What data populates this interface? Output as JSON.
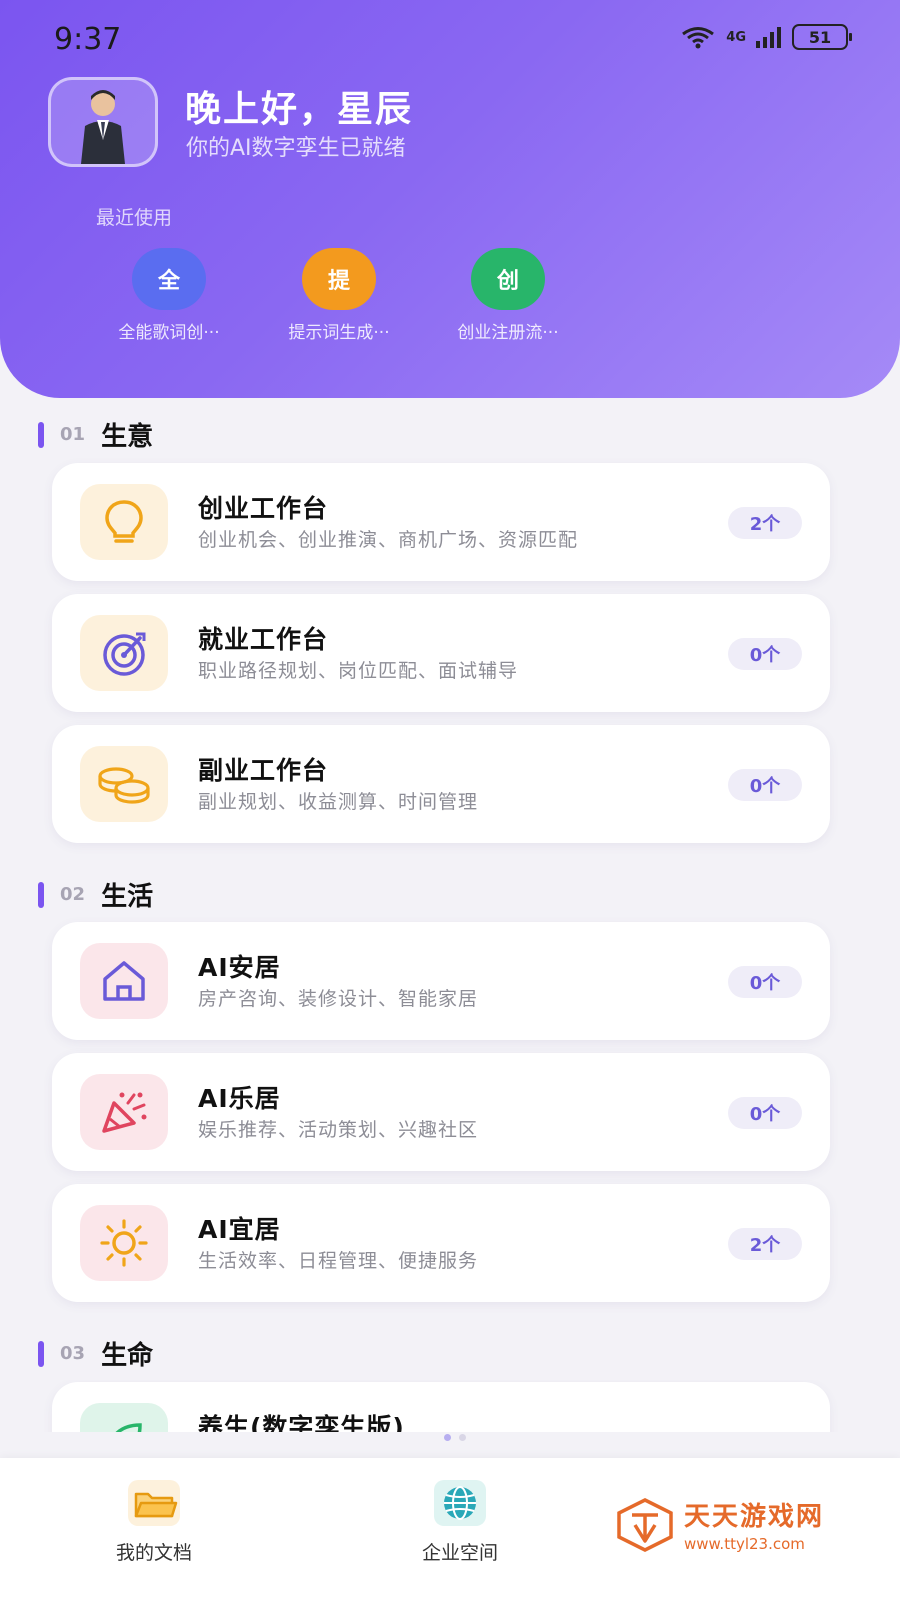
{
  "status_bar": {
    "time": "9:37",
    "network": "4G",
    "battery": "51"
  },
  "header": {
    "greeting": "晚上好，星辰",
    "subtitle": "你的AI数字孪生已就绪",
    "recent_title": "最近使用",
    "recent": [
      {
        "char": "全",
        "label": "全能歌词创···",
        "color": "#5a6df0"
      },
      {
        "char": "提",
        "label": "提示词生成···",
        "color": "#f39a1e"
      },
      {
        "char": "创",
        "label": "创业注册流···",
        "color": "#28b56a"
      }
    ]
  },
  "sections": [
    {
      "num": "01",
      "name": "生意",
      "cards": [
        {
          "title": "创业工作台",
          "desc": "创业机会、创业推演、商机广场、资源匹配",
          "count": "2个",
          "icon": "lightbulb-icon"
        },
        {
          "title": "就业工作台",
          "desc": "职业路径规划、岗位匹配、面试辅导",
          "count": "0个",
          "icon": "target-icon"
        },
        {
          "title": "副业工作台",
          "desc": "副业规划、收益测算、时间管理",
          "count": "0个",
          "icon": "coins-icon"
        }
      ]
    },
    {
      "num": "02",
      "name": "生活",
      "cards": [
        {
          "title": "AI安居",
          "desc": "房产咨询、装修设计、智能家居",
          "count": "0个",
          "icon": "house-icon"
        },
        {
          "title": "AI乐居",
          "desc": "娱乐推荐、活动策划、兴趣社区",
          "count": "0个",
          "icon": "party-popper-icon"
        },
        {
          "title": "AI宜居",
          "desc": "生活效率、日程管理、便捷服务",
          "count": "2个",
          "icon": "sun-icon"
        }
      ]
    },
    {
      "num": "03",
      "name": "生命",
      "cards": [
        {
          "title": "养生(数字孪生版)",
          "desc": "",
          "count": "",
          "icon": "leaf-icon"
        }
      ]
    }
  ],
  "bottom_nav": [
    {
      "label": "我的文档",
      "icon": "folder-icon"
    },
    {
      "label": "企业空间",
      "icon": "globe-icon"
    }
  ],
  "watermark": {
    "title": "天天游戏网",
    "url": "www.ttyl23.com"
  }
}
